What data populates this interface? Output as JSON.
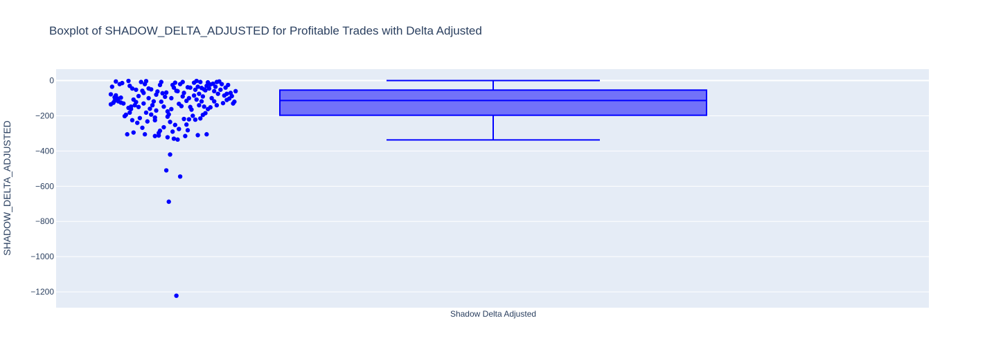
{
  "chart_data": {
    "type": "box",
    "title": "Boxplot of SHADOW_DELTA_ADJUSTED for Profitable Trades with Delta Adjusted",
    "xlabel": "",
    "ylabel": "SHADOW_DELTA_ADJUSTED",
    "categories": [
      "Shadow Delta Adjusted"
    ],
    "ylim": [
      -1290,
      65
    ],
    "yticks": [
      0,
      -200,
      -400,
      -600,
      -800,
      -1000,
      -1200
    ],
    "ytick_labels": [
      "0",
      "−200",
      "−400",
      "−600",
      "−800",
      "−1000",
      "−1200"
    ],
    "grid": true,
    "legend": "none",
    "colors": {
      "plot_bg": "#e5ecf6",
      "grid": "#ffffff",
      "box_fill": "#7272f9",
      "box_line": "#0000ff",
      "points": "#0000ff",
      "title": "#2a3f5f"
    },
    "box": {
      "q1": -197,
      "median": -113,
      "q3": -54,
      "whisker_low": -337,
      "whisker_high": 0
    },
    "points": [
      {
        "jitter": 0.0,
        "y": -78
      },
      {
        "jitter": 0.0,
        "y": -135
      },
      {
        "jitter": 0.01,
        "y": -35
      },
      {
        "jitter": 0.02,
        "y": -126
      },
      {
        "jitter": 0.03,
        "y": -95
      },
      {
        "jitter": 0.03,
        "y": -115
      },
      {
        "jitter": 0.04,
        "y": -5
      },
      {
        "jitter": 0.04,
        "y": -84
      },
      {
        "jitter": 0.05,
        "y": -110
      },
      {
        "jitter": 0.06,
        "y": -102
      },
      {
        "jitter": 0.06,
        "y": -118
      },
      {
        "jitter": 0.07,
        "y": -20
      },
      {
        "jitter": 0.08,
        "y": -125
      },
      {
        "jitter": 0.08,
        "y": -97
      },
      {
        "jitter": 0.09,
        "y": -14
      },
      {
        "jitter": 0.1,
        "y": -130
      },
      {
        "jitter": 0.11,
        "y": -202
      },
      {
        "jitter": 0.12,
        "y": -194
      },
      {
        "jitter": 0.13,
        "y": -305
      },
      {
        "jitter": 0.14,
        "y": -2
      },
      {
        "jitter": 0.14,
        "y": -155
      },
      {
        "jitter": 0.15,
        "y": -30
      },
      {
        "jitter": 0.15,
        "y": -182
      },
      {
        "jitter": 0.16,
        "y": -148
      },
      {
        "jitter": 0.16,
        "y": -162
      },
      {
        "jitter": 0.17,
        "y": -45
      },
      {
        "jitter": 0.17,
        "y": -225
      },
      {
        "jitter": 0.18,
        "y": -295
      },
      {
        "jitter": 0.18,
        "y": -108
      },
      {
        "jitter": 0.19,
        "y": -140
      },
      {
        "jitter": 0.2,
        "y": -52
      },
      {
        "jitter": 0.2,
        "y": -122
      },
      {
        "jitter": 0.21,
        "y": -240
      },
      {
        "jitter": 0.22,
        "y": -88
      },
      {
        "jitter": 0.22,
        "y": -150
      },
      {
        "jitter": 0.23,
        "y": -213
      },
      {
        "jitter": 0.24,
        "y": -8
      },
      {
        "jitter": 0.25,
        "y": -58
      },
      {
        "jitter": 0.25,
        "y": -268
      },
      {
        "jitter": 0.26,
        "y": -70
      },
      {
        "jitter": 0.26,
        "y": -130
      },
      {
        "jitter": 0.27,
        "y": -305
      },
      {
        "jitter": 0.27,
        "y": -20
      },
      {
        "jitter": 0.28,
        "y": -3
      },
      {
        "jitter": 0.28,
        "y": -182
      },
      {
        "jitter": 0.29,
        "y": -232
      },
      {
        "jitter": 0.3,
        "y": -100
      },
      {
        "jitter": 0.3,
        "y": -45
      },
      {
        "jitter": 0.31,
        "y": -160
      },
      {
        "jitter": 0.32,
        "y": -193
      },
      {
        "jitter": 0.32,
        "y": -50
      },
      {
        "jitter": 0.33,
        "y": -140
      },
      {
        "jitter": 0.34,
        "y": -118
      },
      {
        "jitter": 0.35,
        "y": -315
      },
      {
        "jitter": 0.35,
        "y": -210
      },
      {
        "jitter": 0.36,
        "y": -170
      },
      {
        "jitter": 0.36,
        "y": -80
      },
      {
        "jitter": 0.37,
        "y": -62
      },
      {
        "jitter": 0.38,
        "y": -312
      },
      {
        "jitter": 0.38,
        "y": -298
      },
      {
        "jitter": 0.39,
        "y": -25
      },
      {
        "jitter": 0.39,
        "y": -285
      },
      {
        "jitter": 0.4,
        "y": -8
      },
      {
        "jitter": 0.4,
        "y": -120
      },
      {
        "jitter": 0.41,
        "y": -72
      },
      {
        "jitter": 0.42,
        "y": -148
      },
      {
        "jitter": 0.42,
        "y": -265
      },
      {
        "jitter": 0.43,
        "y": -92
      },
      {
        "jitter": 0.44,
        "y": -68
      },
      {
        "jitter": 0.44,
        "y": -510
      },
      {
        "jitter": 0.45,
        "y": -205
      },
      {
        "jitter": 0.45,
        "y": -322
      },
      {
        "jitter": 0.46,
        "y": -192
      },
      {
        "jitter": 0.46,
        "y": -688
      },
      {
        "jitter": 0.47,
        "y": -235
      },
      {
        "jitter": 0.47,
        "y": -420
      },
      {
        "jitter": 0.48,
        "y": -100
      },
      {
        "jitter": 0.48,
        "y": -162
      },
      {
        "jitter": 0.49,
        "y": -290
      },
      {
        "jitter": 0.49,
        "y": -25
      },
      {
        "jitter": 0.5,
        "y": -40
      },
      {
        "jitter": 0.5,
        "y": -330
      },
      {
        "jitter": 0.51,
        "y": -12
      },
      {
        "jitter": 0.51,
        "y": -252
      },
      {
        "jitter": 0.52,
        "y": -58
      },
      {
        "jitter": 0.52,
        "y": -1222
      },
      {
        "jitter": 0.53,
        "y": -60
      },
      {
        "jitter": 0.53,
        "y": -335
      },
      {
        "jitter": 0.54,
        "y": -275
      },
      {
        "jitter": 0.54,
        "y": -132
      },
      {
        "jitter": 0.55,
        "y": -545
      },
      {
        "jitter": 0.55,
        "y": -20
      },
      {
        "jitter": 0.56,
        "y": -145
      },
      {
        "jitter": 0.57,
        "y": -90
      },
      {
        "jitter": 0.57,
        "y": -8
      },
      {
        "jitter": 0.58,
        "y": -70
      },
      {
        "jitter": 0.58,
        "y": -218
      },
      {
        "jitter": 0.59,
        "y": -315
      },
      {
        "jitter": 0.6,
        "y": -250
      },
      {
        "jitter": 0.6,
        "y": -115
      },
      {
        "jitter": 0.61,
        "y": -282
      },
      {
        "jitter": 0.61,
        "y": -38
      },
      {
        "jitter": 0.62,
        "y": -100
      },
      {
        "jitter": 0.62,
        "y": -220
      },
      {
        "jitter": 0.63,
        "y": -150
      },
      {
        "jitter": 0.63,
        "y": -40
      },
      {
        "jitter": 0.64,
        "y": -165
      },
      {
        "jitter": 0.65,
        "y": -200
      },
      {
        "jitter": 0.66,
        "y": -12
      },
      {
        "jitter": 0.66,
        "y": -85
      },
      {
        "jitter": 0.67,
        "y": -52
      },
      {
        "jitter": 0.67,
        "y": -222
      },
      {
        "jitter": 0.68,
        "y": -2
      },
      {
        "jitter": 0.68,
        "y": -108
      },
      {
        "jitter": 0.69,
        "y": -310
      },
      {
        "jitter": 0.69,
        "y": -35
      },
      {
        "jitter": 0.7,
        "y": -140
      },
      {
        "jitter": 0.7,
        "y": -75
      },
      {
        "jitter": 0.71,
        "y": -215
      },
      {
        "jitter": 0.71,
        "y": -8
      },
      {
        "jitter": 0.72,
        "y": -118
      },
      {
        "jitter": 0.72,
        "y": -42
      },
      {
        "jitter": 0.73,
        "y": -195
      },
      {
        "jitter": 0.73,
        "y": -90
      },
      {
        "jitter": 0.74,
        "y": -50
      },
      {
        "jitter": 0.74,
        "y": -148
      },
      {
        "jitter": 0.75,
        "y": -185
      },
      {
        "jitter": 0.75,
        "y": -55
      },
      {
        "jitter": 0.76,
        "y": -305
      },
      {
        "jitter": 0.76,
        "y": -30
      },
      {
        "jitter": 0.77,
        "y": -162
      },
      {
        "jitter": 0.77,
        "y": -10
      },
      {
        "jitter": 0.78,
        "y": -45
      },
      {
        "jitter": 0.79,
        "y": -152
      },
      {
        "jitter": 0.79,
        "y": -22
      },
      {
        "jitter": 0.8,
        "y": -100
      },
      {
        "jitter": 0.81,
        "y": -18
      },
      {
        "jitter": 0.82,
        "y": -60
      },
      {
        "jitter": 0.82,
        "y": -118
      },
      {
        "jitter": 0.83,
        "y": -35
      },
      {
        "jitter": 0.84,
        "y": -8
      },
      {
        "jitter": 0.84,
        "y": -140
      },
      {
        "jitter": 0.85,
        "y": -75
      },
      {
        "jitter": 0.86,
        "y": -5
      },
      {
        "jitter": 0.87,
        "y": -52
      },
      {
        "jitter": 0.88,
        "y": -20
      },
      {
        "jitter": 0.89,
        "y": -128
      },
      {
        "jitter": 0.9,
        "y": -85
      },
      {
        "jitter": 0.91,
        "y": -40
      },
      {
        "jitter": 0.92,
        "y": -110
      },
      {
        "jitter": 0.93,
        "y": -25
      },
      {
        "jitter": 0.94,
        "y": -102
      },
      {
        "jitter": 0.95,
        "y": -70
      },
      {
        "jitter": 0.96,
        "y": -88
      },
      {
        "jitter": 0.97,
        "y": -130
      },
      {
        "jitter": 0.98,
        "y": -120
      },
      {
        "jitter": 0.99,
        "y": -60
      },
      {
        "jitter": 0.92,
        "y": -75
      },
      {
        "jitter": 0.35,
        "y": -225
      },
      {
        "jitter": 0.45,
        "y": -175
      }
    ]
  }
}
